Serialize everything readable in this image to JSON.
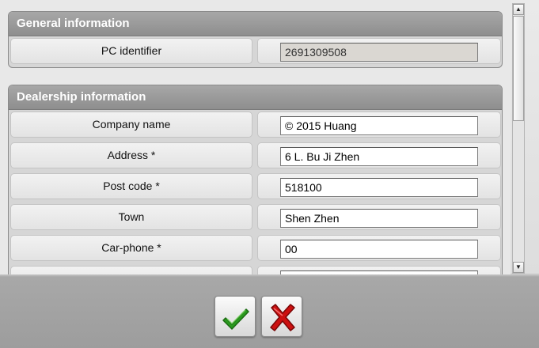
{
  "general": {
    "title": "General information",
    "rows": [
      {
        "label": "PC identifier",
        "value": "2691309508",
        "readonly": true
      }
    ]
  },
  "dealership": {
    "title": "Dealership information",
    "rows": [
      {
        "label": "Company name",
        "value": "© 2015 Huang"
      },
      {
        "label": "Address *",
        "value": "6 L. Bu Ji Zhen"
      },
      {
        "label": "Post code *",
        "value": "518100"
      },
      {
        "label": "Town",
        "value": "Shen Zhen"
      },
      {
        "label": "Car-phone *",
        "value": "00"
      },
      {
        "label": "",
        "value": ""
      }
    ]
  },
  "actions": {
    "confirm_icon": "green-checkmark-icon",
    "cancel_icon": "red-x-icon"
  },
  "colors": {
    "header_bg": "#989898",
    "confirm": "#2a9a1e",
    "cancel": "#cc1010"
  },
  "scrollbar": {
    "up_icon": "▲",
    "down_icon": "▼"
  }
}
